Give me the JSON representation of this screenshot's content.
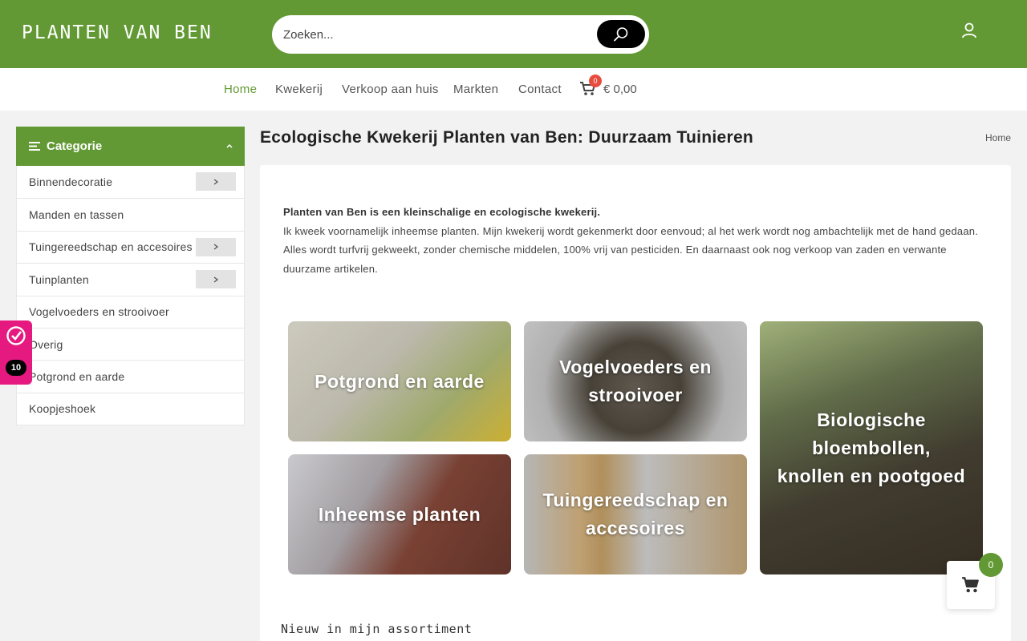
{
  "header": {
    "logo": "PLANTEN VAN BEN",
    "search_placeholder": "Zoeken...",
    "search_icon": "search-icon",
    "user_icon": "user-icon",
    "brand_color": "#629934"
  },
  "nav": {
    "items": [
      {
        "label": "Home",
        "active": true
      },
      {
        "label": "Kwekerij"
      },
      {
        "label": "Verkoop aan huis"
      },
      {
        "label": "Markten"
      },
      {
        "label": "Contact"
      }
    ],
    "cart_count": "0",
    "cart_total": "€ 0,00"
  },
  "sidebar": {
    "title": "Categorie",
    "items": [
      {
        "label": "Binnendecoratie",
        "has_submenu": true
      },
      {
        "label": "Manden en tassen"
      },
      {
        "label": "Tuingereedschap en accesoires",
        "has_submenu": true
      },
      {
        "label": "Tuinplanten",
        "has_submenu": true
      },
      {
        "label": "Vogelvoeders en strooivoer"
      },
      {
        "label": "Overig"
      },
      {
        "label": "Potgrond en aarde"
      },
      {
        "label": "Koopjeshoek"
      }
    ]
  },
  "review_widget": {
    "score": "10"
  },
  "main": {
    "title": "Ecologische Kwekerij Planten van Ben: Duurzaam Tuinieren",
    "breadcrumb": "Home",
    "intro_bold": "Planten van Ben is een kleinschalige en ecologische kwekerij.",
    "intro_text": "Ik kweek voornamelijk inheemse planten. Mijn kwekerij wordt gekenmerkt door eenvoud; al het werk wordt nog ambachtelijk met de hand gedaan. Alles wordt turfvrij gekweekt, zonder chemische middelen, 100% vrij van pesticiden. En daarnaast ook nog verkoop van zaden en verwante duurzame artikelen.",
    "tiles": [
      {
        "label": "Potgrond en aarde"
      },
      {
        "label": "Vogelvoeders en strooivoer"
      },
      {
        "label": "Biologische bloembollen, knollen en pootgoed"
      },
      {
        "label": "Inheemse planten"
      },
      {
        "label": "Tuingereedschap en accesoires"
      }
    ],
    "section_title": "Nieuw in mijn assortiment"
  },
  "floating_cart": {
    "count": "0"
  }
}
